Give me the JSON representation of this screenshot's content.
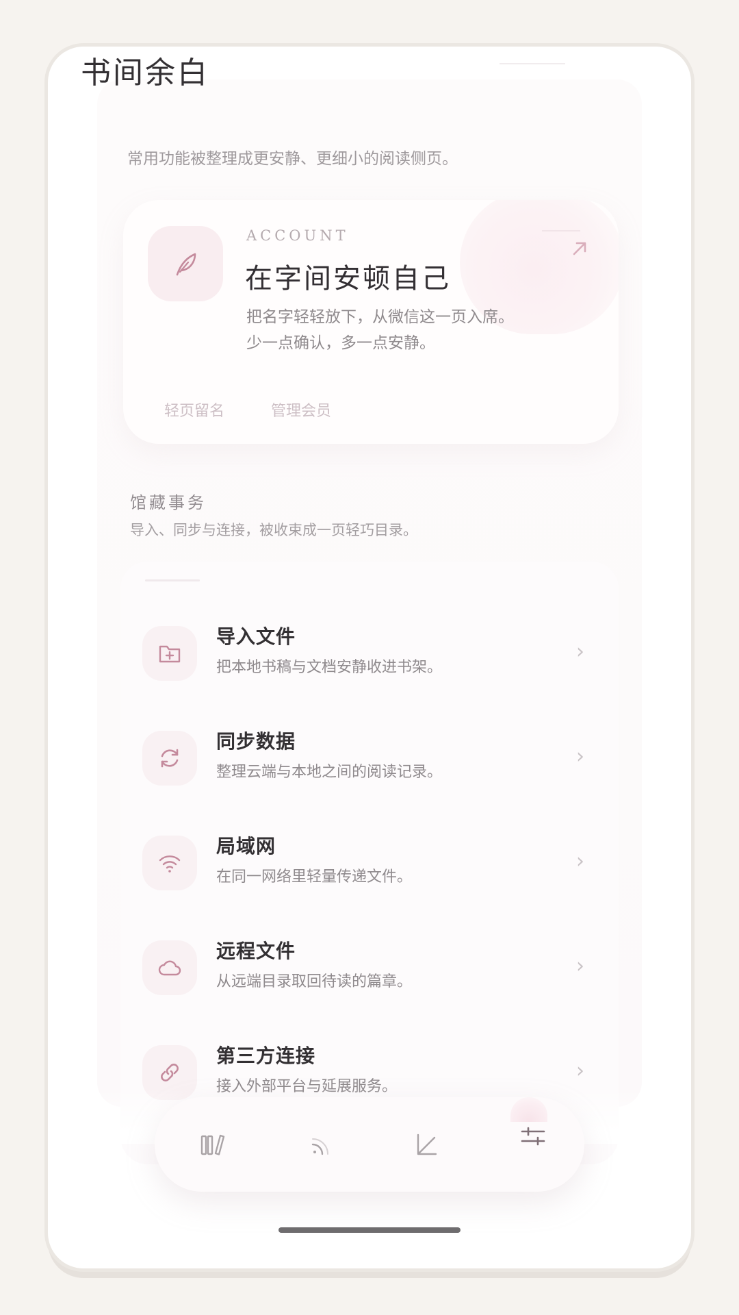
{
  "header": {
    "title": "书间余白",
    "subtitle": "常用功能被整理成更安静、更细小的阅读侧页。"
  },
  "account": {
    "kicker": "ACCOUNT",
    "heading": "在字间安顿自己",
    "desc_line1": "把名字轻轻放下，从微信这一页入席。",
    "desc_line2": "少一点确认，多一点安静。",
    "link_signin": "轻页留名",
    "link_member": "管理会员",
    "icon": "feather-icon"
  },
  "collection": {
    "title": "馆藏事务",
    "desc": "导入、同步与连接，被收束成一页轻巧目录。",
    "items": [
      {
        "title": "导入文件",
        "desc": "把本地书稿与文档安静收进书架。",
        "icon": "folder-plus-icon"
      },
      {
        "title": "同步数据",
        "desc": "整理云端与本地之间的阅读记录。",
        "icon": "sync-icon"
      },
      {
        "title": "局域网",
        "desc": "在同一网络里轻量传递文件。",
        "icon": "wifi-icon"
      },
      {
        "title": "远程文件",
        "desc": "从远端目录取回待读的篇章。",
        "icon": "cloud-icon"
      },
      {
        "title": "第三方连接",
        "desc": "接入外部平台与延展服务。",
        "icon": "link-icon"
      }
    ],
    "chevron": "›"
  },
  "tabbar": {
    "tabs": [
      "bookshelf-icon",
      "rss-icon",
      "chart-icon",
      "settings-sliders-icon"
    ],
    "active": "settings-sliders-icon"
  },
  "colors": {
    "accent": "#c48a9c",
    "background": "#f6f3ef",
    "text": "#333033"
  }
}
